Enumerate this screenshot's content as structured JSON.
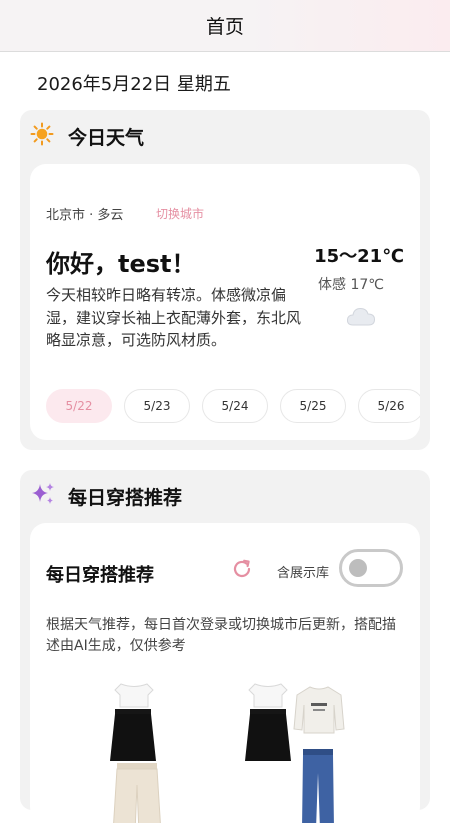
{
  "header": {
    "title": "首页"
  },
  "date": "2026年5月22日 星期五",
  "weather": {
    "section_title": "今日天气",
    "icon": "sun-icon",
    "city": "北京市 · 多云",
    "switch_city": "切换城市",
    "greeting": "你好，test！",
    "description": "今天相较昨日略有转凉。体感微凉偏湿，建议穿长袖上衣配薄外套，东北风略显凉意，可选防风材质。",
    "temperature": "15～21℃",
    "feels_like": "体感 17℃",
    "condition_icon": "cloud-icon",
    "dates": [
      {
        "label": "5/22",
        "active": true
      },
      {
        "label": "5/23",
        "active": false
      },
      {
        "label": "5/24",
        "active": false
      },
      {
        "label": "5/25",
        "active": false
      },
      {
        "label": "5/26",
        "active": false
      }
    ]
  },
  "outfit": {
    "section_title": "每日穿搭推荐",
    "icon": "sparkle-icon",
    "card_title": "每日穿搭推荐",
    "demo_toggle_label": "含展示库",
    "demo_toggle_on": false,
    "description": "根据天气推荐，每日首次登录或切换城市后更新，搭配描述由AI生成，仅供参考",
    "looks": [
      {
        "items": [
          "white-crop-top",
          "black-skirt",
          "beige-wide-pants"
        ]
      },
      {
        "items": [
          "white-crop-top",
          "black-skirt",
          "white-sweatshirt",
          "blue-jeans"
        ]
      }
    ]
  },
  "colors": {
    "accent_pink": "#e58fa2",
    "active_pill_bg": "#fce9ee",
    "sun": "#f29a1e",
    "sparkle": "#9b5fd1"
  }
}
